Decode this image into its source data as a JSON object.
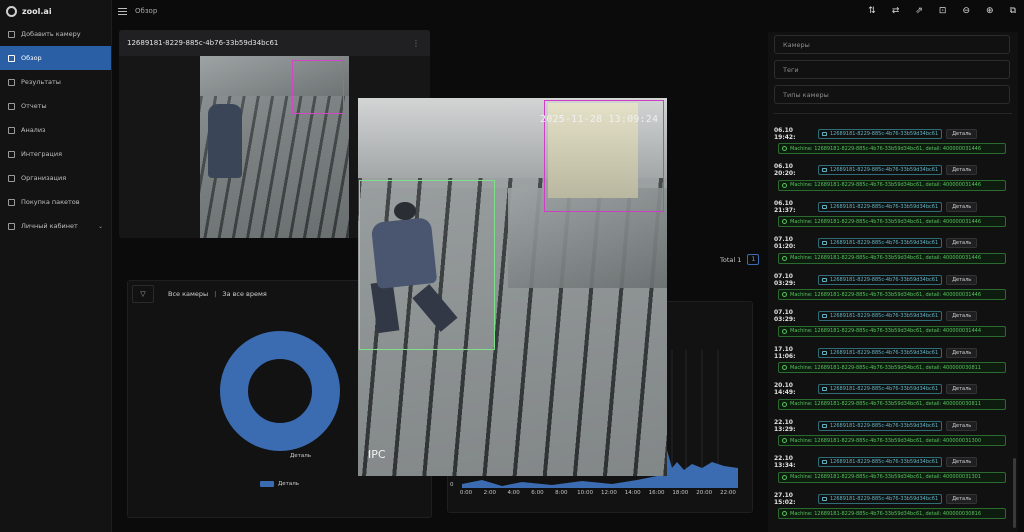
{
  "app": {
    "name": "zool.ai",
    "breadcrumb": "Обзор"
  },
  "sidebar": {
    "items": [
      {
        "label": "Добавить камеру",
        "active": false
      },
      {
        "label": "Обзор",
        "active": true
      },
      {
        "label": "Результаты",
        "active": false
      },
      {
        "label": "Отчеты",
        "active": false
      },
      {
        "label": "Анализ",
        "active": false
      },
      {
        "label": "Интеграция",
        "active": false
      },
      {
        "label": "Организация",
        "active": false
      },
      {
        "label": "Покупка пакетов",
        "active": false
      },
      {
        "label": "Личный кабинет",
        "active": false,
        "has_chevron": true
      }
    ]
  },
  "toolbar_icons": [
    "sort-icon",
    "swap-icon",
    "export-icon",
    "lock-icon",
    "zoom-out-icon",
    "zoom-in-icon",
    "crop-icon"
  ],
  "camera_card": {
    "id": "12689181-8229-885c-4b76-33b59d34bc61",
    "menu": "⋮"
  },
  "pagination": {
    "total_label": "Total",
    "total": "1",
    "page": "1"
  },
  "stats": {
    "filter_camera": "Все камеры",
    "separator": "|",
    "filter_period": "За все время",
    "callout": "Деталь",
    "legend": "Деталь"
  },
  "timeline": {
    "zero": "0",
    "ticks": [
      "0:00",
      "2:00",
      "4:00",
      "6:00",
      "8:00",
      "10:00",
      "12:00",
      "14:00",
      "16:00",
      "18:00",
      "20:00",
      "22:00"
    ]
  },
  "camera_view": {
    "timestamp": "2025-11-28 13:09:24",
    "label": "IPC"
  },
  "filters": {
    "cameras_placeholder": "Камеры",
    "tags_placeholder": "Теги",
    "types_placeholder": "Типы камеры"
  },
  "events": [
    {
      "time": "06.10 19:42:",
      "camera": "12689181-8229-885c-4b76-33b59d34bc61",
      "button": "Деталь",
      "detail": "Machine: 12689181-8229-885c-4b76-33b59d34bc61, detail: 400000031446"
    },
    {
      "time": "06.10 20:20:",
      "camera": "12689181-8229-885c-4b76-33b59d34bc61",
      "button": "Деталь",
      "detail": "Machine: 12689181-8229-885c-4b76-33b59d34bc61, detail: 400000031446"
    },
    {
      "time": "06.10 21:37:",
      "camera": "12689181-8229-885c-4b76-33b59d34bc61",
      "button": "Деталь",
      "detail": "Machine: 12689181-8229-885c-4b76-33b59d34bc61, detail: 400000031446"
    },
    {
      "time": "07.10 01:20:",
      "camera": "12689181-8229-885c-4b76-33b59d34bc61",
      "button": "Деталь",
      "detail": "Machine: 12689181-8229-885c-4b76-33b59d34bc61, detail: 400000031446"
    },
    {
      "time": "07.10 03:29:",
      "camera": "12689181-8229-885c-4b76-33b59d34bc61",
      "button": "Деталь",
      "detail": "Machine: 12689181-8229-885c-4b76-33b59d34bc61, detail: 400000031446"
    },
    {
      "time": "07.10 03:29:",
      "camera": "12689181-8229-885c-4b76-33b59d34bc61",
      "button": "Деталь",
      "detail": "Machine: 12689181-8229-885c-4b76-33b59d34bc61, detail: 400000031444"
    },
    {
      "time": "17.10 11:06:",
      "camera": "12689181-8229-885c-4b76-33b59d34bc61",
      "button": "Деталь",
      "detail": "Machine: 12689181-8229-885c-4b76-33b59d34bc61, detail: 400000030811"
    },
    {
      "time": "20.10 14:49:",
      "camera": "12689181-8229-885c-4b76-33b59d34bc61",
      "button": "Деталь",
      "detail": "Machine: 12689181-8229-885c-4b76-33b59d34bc61, detail: 400000030811"
    },
    {
      "time": "22.10 13:29:",
      "camera": "12689181-8229-885c-4b76-33b59d34bc61",
      "button": "Деталь",
      "detail": "Machine: 12689181-8229-885c-4b76-33b59d34bc61, detail: 400000031300"
    },
    {
      "time": "22.10 13:34:",
      "camera": "12689181-8229-885c-4b76-33b59d34bc61",
      "button": "Деталь",
      "detail": "Machine: 12689181-8229-885c-4b76-33b59d34bc61, detail: 400000031301"
    },
    {
      "time": "27.10 15:02:",
      "camera": "12689181-8229-885c-4b76-33b59d34bc61",
      "button": "Деталь",
      "detail": "Machine: 12689181-8229-885c-4b76-33b59d34bc61, detail: 400000030816"
    }
  ]
}
